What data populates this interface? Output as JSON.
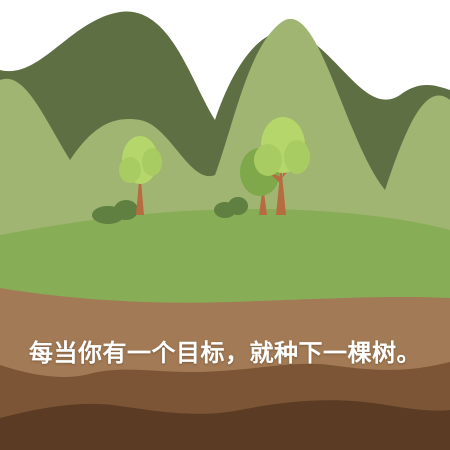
{
  "caption": "每当你有一个目标，就种下一棵树。",
  "colors": {
    "background": "#ffffff",
    "mountain_far": "#5f6f44",
    "mountain_near": "#9fb571",
    "hill": "#88ad57",
    "soil_light": "#a27a55",
    "soil_mid": "#7b5535",
    "soil_dark": "#5b3b24",
    "tree_leaf_light": "#b5d66a",
    "tree_leaf_dark": "#7ea84a",
    "trunk": "#b76b40",
    "bush": "#5f8040",
    "caption_text": "#ffffff"
  },
  "icons": [
    "tree-icon",
    "bush-icon",
    "mountain-icon"
  ]
}
